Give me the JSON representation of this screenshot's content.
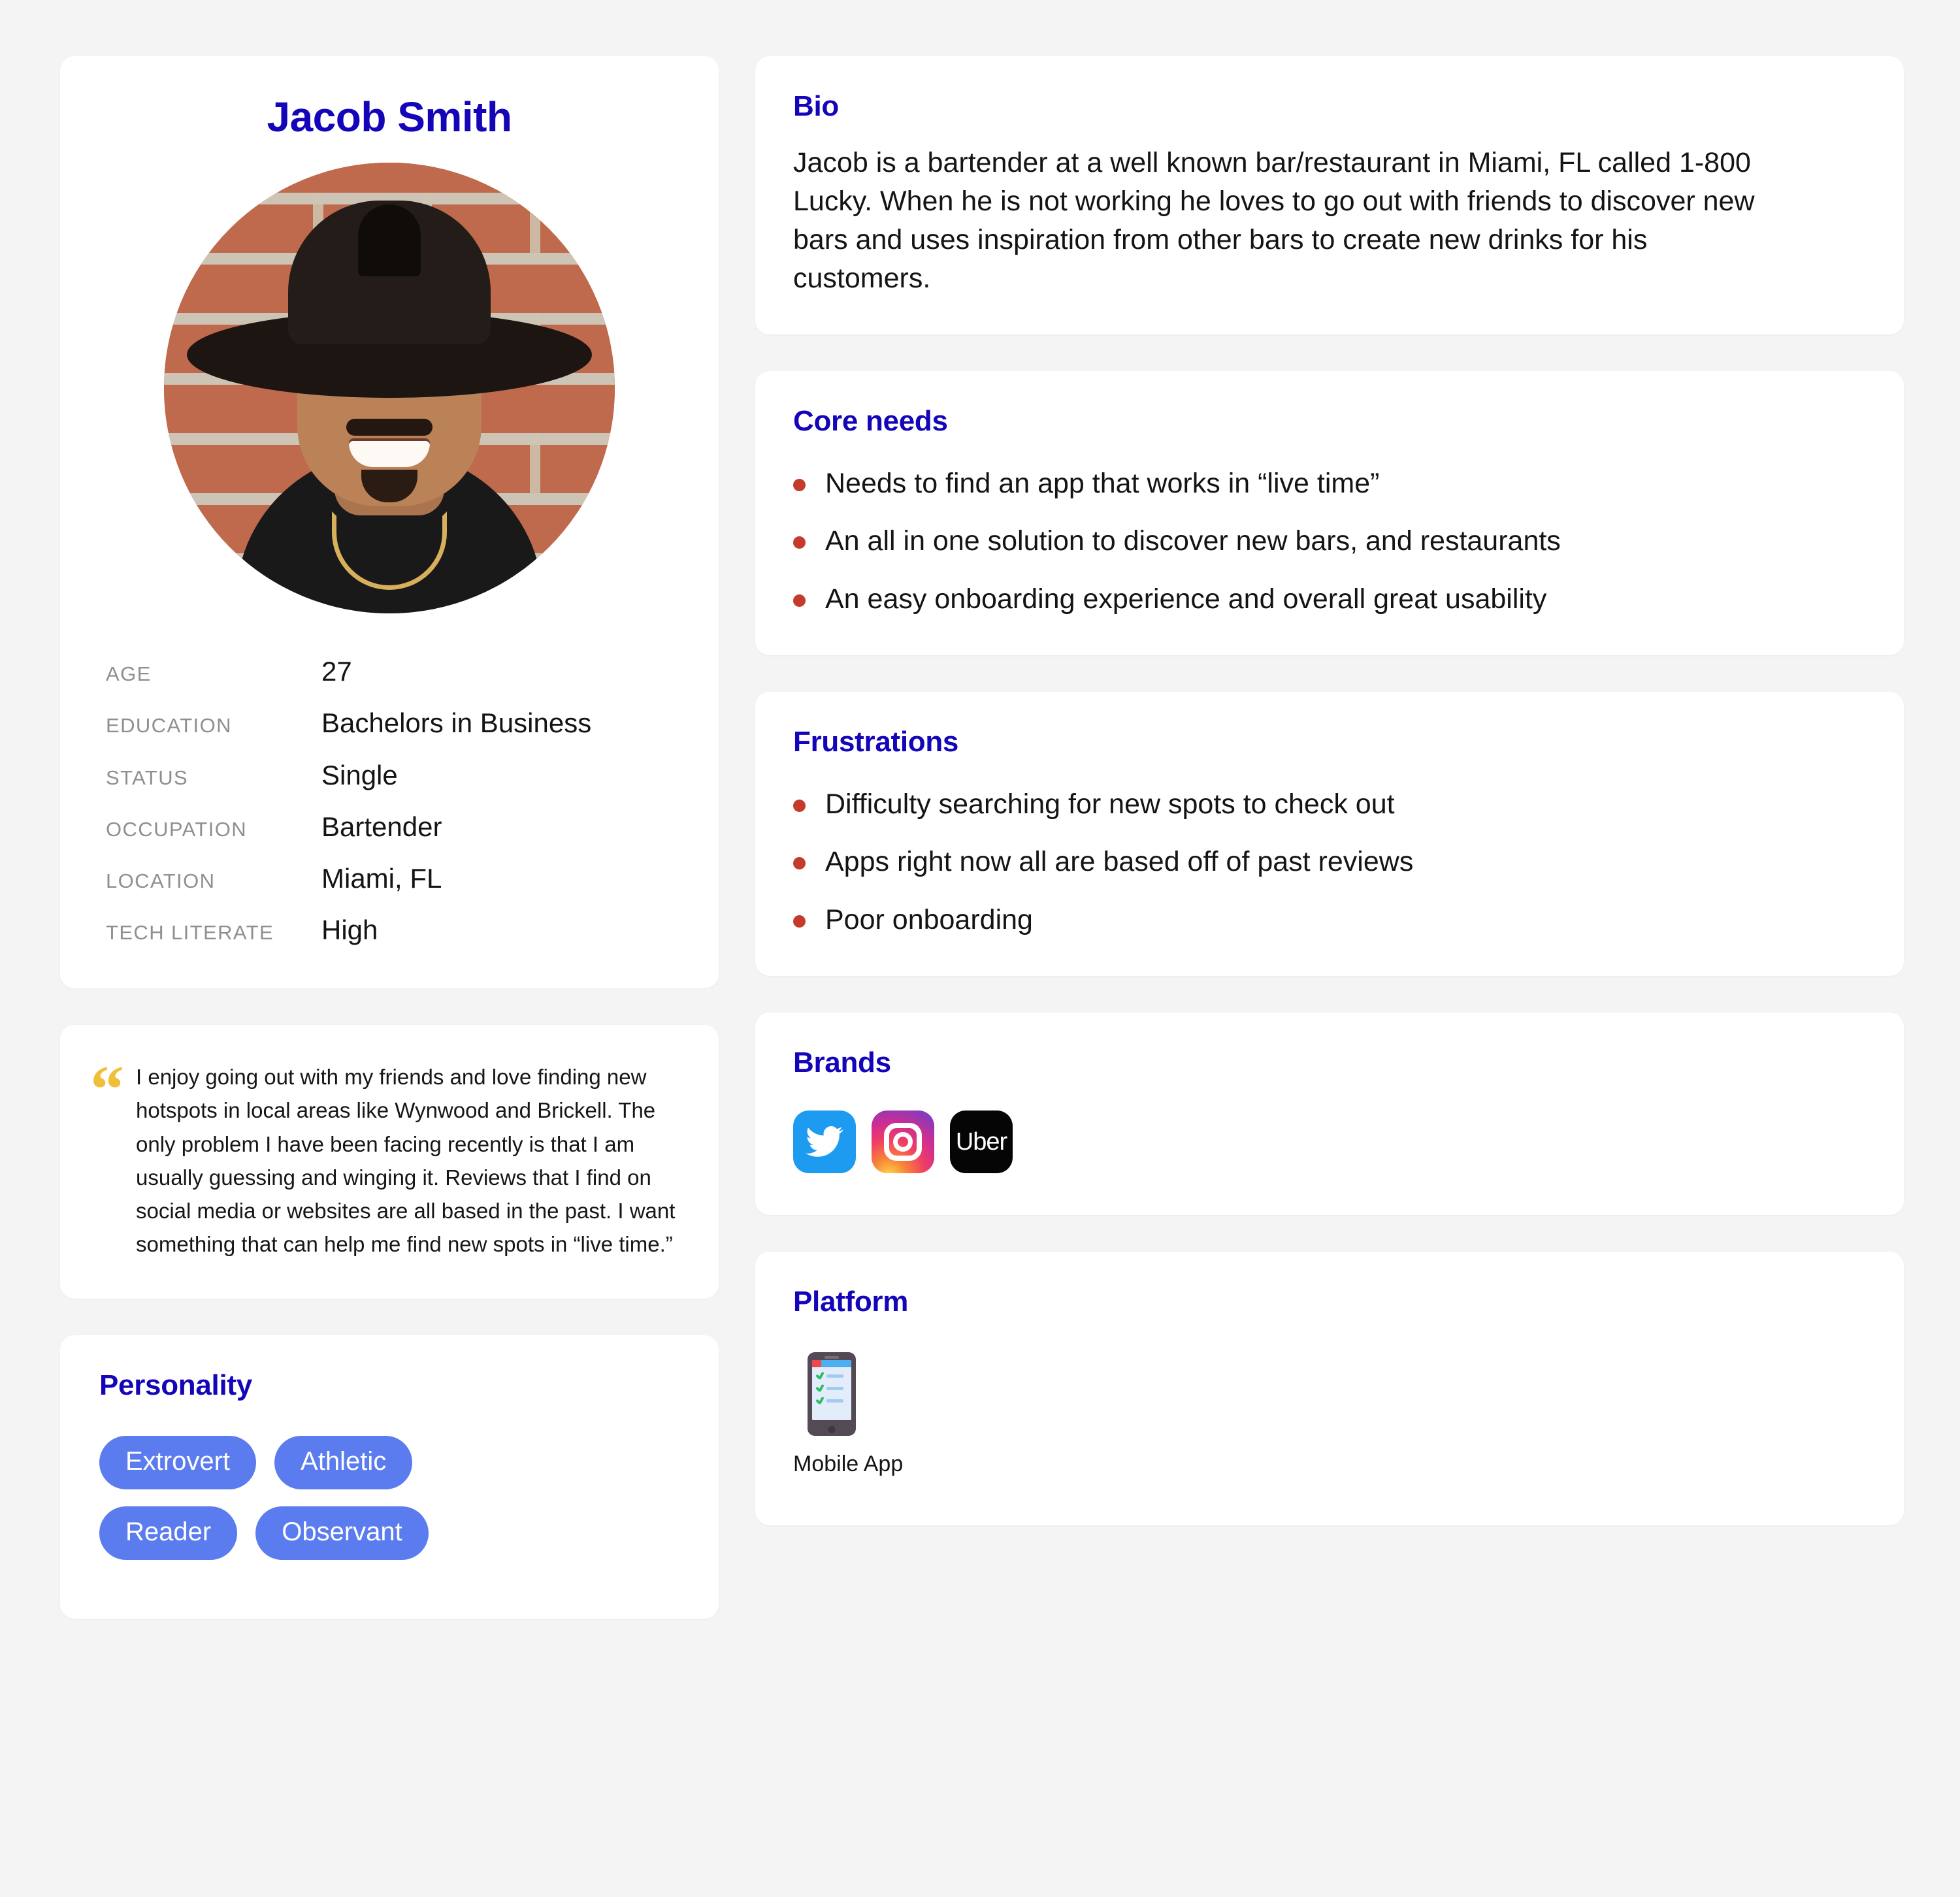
{
  "colors": {
    "heading_blue": "#1405b8",
    "bullet_red": "#c43b2c",
    "pill_blue": "#5b7cee",
    "quote_gold": "#efbf3a",
    "page_bg": "#f4f4f4",
    "card_bg": "#ffffff"
  },
  "profile": {
    "name": "Jacob Smith",
    "avatar_alt": "portrait-photo-man-in-black-fedora-hat-against-red-brick-wall",
    "attributes": [
      {
        "label": "AGE",
        "value": "27"
      },
      {
        "label": "EDUCATION",
        "value": "Bachelors in Business"
      },
      {
        "label": "STATUS",
        "value": "Single"
      },
      {
        "label": "OCCUPATION",
        "value": "Bartender"
      },
      {
        "label": "LOCATION",
        "value": "Miami, FL"
      },
      {
        "label": "TECH  LITERATE",
        "value": "High"
      }
    ]
  },
  "quote": {
    "mark": "“",
    "text": "I enjoy going out with my friends and love finding new hotspots in local areas like Wynwood and Brickell. The only problem I have been facing recently is that I am usually guessing and winging it. Reviews that I find on social media or websites are all based in the past. I want something that can help me find new spots in “live time.”"
  },
  "personality": {
    "title": "Personality",
    "traits": [
      {
        "label": "Extrovert"
      },
      {
        "label": "Athletic"
      },
      {
        "label": "Reader"
      },
      {
        "label": "Observant"
      }
    ]
  },
  "bio": {
    "title": "Bio",
    "text": "Jacob is a bartender at a well known bar/restaurant in Miami, FL called 1-800 Lucky. When he is not working he loves to go out with friends to discover new bars and uses inspiration from other bars to create new drinks for his customers."
  },
  "core_needs": {
    "title": "Core needs",
    "items": [
      {
        "text": "Needs to find an app that works in “live time”"
      },
      {
        "text": "An all in one solution to discover new bars, and restaurants"
      },
      {
        "text": "An easy onboarding experience and overall great usability"
      }
    ]
  },
  "frustrations": {
    "title": "Frustrations",
    "items": [
      {
        "text": "Difficulty searching for new spots to check out"
      },
      {
        "text": "Apps right now all are based off of past reviews"
      },
      {
        "text": "Poor onboarding"
      }
    ]
  },
  "brands": {
    "title": "Brands",
    "items": [
      {
        "name": "Twitter",
        "icon": "twitter-icon"
      },
      {
        "name": "Instagram",
        "icon": "instagram-icon"
      },
      {
        "name": "Uber",
        "icon": "uber-icon",
        "wordmark": "Uber"
      }
    ]
  },
  "platform": {
    "title": "Platform",
    "items": [
      {
        "label": "Mobile App",
        "icon": "mobile-phone-checklist-icon"
      }
    ]
  }
}
